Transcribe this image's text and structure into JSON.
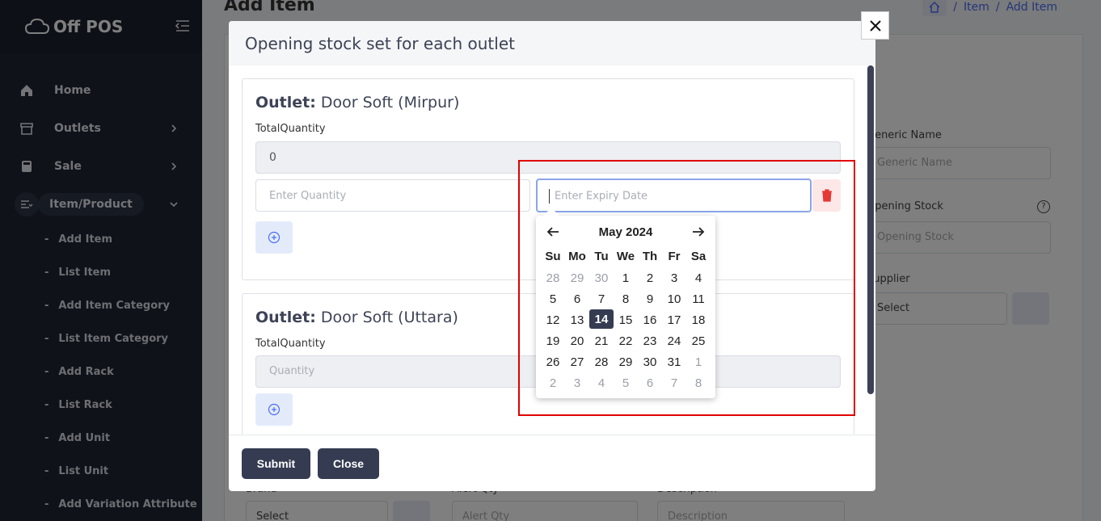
{
  "app": {
    "brand": "Off POS",
    "page_title": "Add Item"
  },
  "breadcrumb": [
    "Item",
    "Add Item"
  ],
  "sidebar": {
    "items": [
      {
        "label": "Home",
        "icon": "home-icon",
        "has_children": false
      },
      {
        "label": "Outlets",
        "icon": "store-icon",
        "has_children": true
      },
      {
        "label": "Sale",
        "icon": "calculator-icon",
        "has_children": true
      },
      {
        "label": "Item/Product",
        "icon": "list-icon",
        "has_children": true,
        "expanded": true
      }
    ],
    "subitems": [
      "Add Item",
      "List Item",
      "Add Item Category",
      "List Item Category",
      "Add Rack",
      "List Rack",
      "Add Unit",
      "List Unit",
      "Add Variation Attribute"
    ]
  },
  "background_form": {
    "generic_name_label": "Generic Name",
    "generic_name_placeholder": "Generic Name",
    "opening_stock_label": "Opening Stock",
    "opening_stock_placeholder": "Opening Stock",
    "supplier_label": "Supplier",
    "supplier_value": "Select",
    "brand_label": "Brand",
    "brand_value": "Select",
    "alert_qty_label": "Alert Qty",
    "alert_qty_placeholder": "Alert Qty",
    "description_label": "Description",
    "description_placeholder": "Description"
  },
  "modal": {
    "title": "Opening stock set for each outlet",
    "outlet_prefix": "Outlet:",
    "outlets": [
      {
        "name": "Door Soft (Mirpur)",
        "total_label": "TotalQuantity",
        "total_value": "0",
        "quantity_placeholder": "Enter Quantity",
        "expiry_placeholder": "Enter Expiry Date"
      },
      {
        "name": "Door Soft (Uttara)",
        "total_label": "TotalQuantity",
        "total_placeholder": "Quantity"
      }
    ],
    "submit_label": "Submit",
    "close_label": "Close"
  },
  "datepicker": {
    "month": "May 2024",
    "weekdays": [
      "Su",
      "Mo",
      "Tu",
      "We",
      "Th",
      "Fr",
      "Sa"
    ],
    "weeks": [
      [
        [
          "28",
          1
        ],
        [
          "29",
          1
        ],
        [
          "30",
          1
        ],
        [
          "1",
          0
        ],
        [
          "2",
          0
        ],
        [
          "3",
          0
        ],
        [
          "4",
          0
        ]
      ],
      [
        [
          "5",
          0
        ],
        [
          "6",
          0
        ],
        [
          "7",
          0
        ],
        [
          "8",
          0
        ],
        [
          "9",
          0
        ],
        [
          "10",
          0
        ],
        [
          "11",
          0
        ]
      ],
      [
        [
          "12",
          0
        ],
        [
          "13",
          0
        ],
        [
          "14",
          2
        ],
        [
          "15",
          0
        ],
        [
          "16",
          0
        ],
        [
          "17",
          0
        ],
        [
          "18",
          0
        ]
      ],
      [
        [
          "19",
          0
        ],
        [
          "20",
          0
        ],
        [
          "21",
          0
        ],
        [
          "22",
          0
        ],
        [
          "23",
          0
        ],
        [
          "24",
          0
        ],
        [
          "25",
          0
        ]
      ],
      [
        [
          "26",
          0
        ],
        [
          "27",
          0
        ],
        [
          "28",
          0
        ],
        [
          "29",
          0
        ],
        [
          "30",
          0
        ],
        [
          "31",
          0
        ],
        [
          "1",
          1
        ]
      ],
      [
        [
          "2",
          1
        ],
        [
          "3",
          1
        ],
        [
          "4",
          1
        ],
        [
          "5",
          1
        ],
        [
          "6",
          1
        ],
        [
          "7",
          1
        ],
        [
          "8",
          1
        ]
      ]
    ],
    "selected_day": "14"
  },
  "colors": {
    "sidebar_bg": "#1f2432",
    "primary_button": "#353c52",
    "link": "#4a6cf7",
    "danger": "#e53935",
    "highlight": "#e00000"
  }
}
